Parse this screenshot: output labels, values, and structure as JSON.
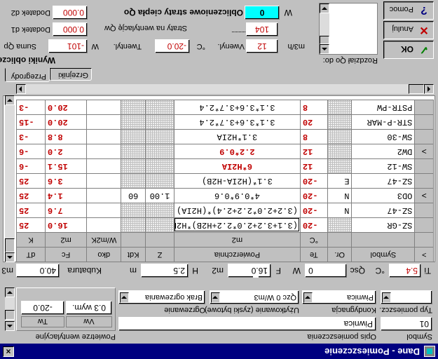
{
  "window": {
    "title": "Dane - Pomieszczenie",
    "close_glyph": "×"
  },
  "room": {
    "symbol_label": "Symbol",
    "symbol_value": "01",
    "description_label": "Opis pomieszczenia",
    "description_value": "Piwnica",
    "type_label": "Typ pomieszcz.",
    "type_value": "",
    "floor_label": "Kondygnacja",
    "floor_value": "Piwnica",
    "usage_label": "Użytkowanie (zyski bytowe)",
    "usage_value": "Qzc 0 W/m3",
    "heating_label": "Ogrzewanie",
    "heating_value": "Brak ogrzewania"
  },
  "ventilation_air": {
    "caption": "Powietrze wentylacyjne",
    "col_vw": "Vw",
    "col_tw": "Tw",
    "vw_value": "0.3  wym.",
    "tw_value": "-20.0"
  },
  "params": {
    "ti_label": "Ti",
    "ti_value": "5.4",
    "ti_unit": "°C",
    "qsc_label": "Qsc",
    "qsc_value": "0",
    "qsc_unit": "W",
    "f_label": "F",
    "f_value": "16.0",
    "f_unit": "m2",
    "h_label": "H",
    "h_value": "2.5",
    "h_unit": "m",
    "kub_label": "Kubatura",
    "kub_value": "40.0",
    "kub_unit": "m3"
  },
  "table": {
    "headers_row1": [
      ">",
      "Symbol",
      "Or.",
      "Te",
      "Powierzchnia",
      "Z",
      "Kdt",
      "dko",
      "Fc",
      "dT"
    ],
    "headers_row2": [
      "",
      "",
      "",
      "°C",
      "m2",
      "",
      "",
      "W/m2K",
      "m2",
      "K"
    ],
    "rows": [
      {
        "ind": "",
        "sym": "SZ-GR",
        "or": "",
        "te": "-20",
        "area": "(3.1+3.2+2.0*2.2+H2B)*H2R",
        "z": "",
        "kdt": "",
        "dko": "",
        "fc": "16.0",
        "dt": "25",
        "editing": true
      },
      {
        "ind": "",
        "sym": "SZ-47",
        "or": "N",
        "te": "-20",
        "area": "(3.2+2.0*2.2+2.4)*(H2IA)",
        "z": "",
        "kdt": "",
        "dko": "",
        "fc": "7.6",
        "dt": "25"
      },
      {
        "ind": ">",
        "sym": "OD3",
        "or": "N",
        "te": "-20",
        "area": "4*0.9*0.6",
        "z": "1.00",
        "kdt": "60",
        "dko": "",
        "fc": "1.4",
        "dt": "25"
      },
      {
        "ind": "",
        "sym": "SZ-47",
        "or": "E",
        "te": "-20",
        "area": "3.1*(H2IA-H2B)",
        "z": "",
        "kdt": "",
        "dko": "",
        "fc": "3.6",
        "dt": "25"
      },
      {
        "ind": "",
        "sym": "SW-12",
        "or": "",
        "te": "12",
        "area": "6*H2IA",
        "z": "",
        "kdt": "",
        "dko": "",
        "fc": "15.1",
        "dt": "-6"
      },
      {
        "ind": ">",
        "sym": "DW2",
        "or": "",
        "te": "12",
        "area": "2.2*0.9",
        "z": "",
        "kdt": "",
        "dko": "",
        "fc": "2.0",
        "dt": "-6"
      },
      {
        "ind": "",
        "sym": "SW-30",
        "or": "",
        "te": "8",
        "area": "3.1*H2IA",
        "z": "",
        "kdt": "",
        "dko": "",
        "fc": "8.8",
        "dt": "-3"
      },
      {
        "ind": "",
        "sym": "STR-P-MAR",
        "or": "",
        "te": "20",
        "area": "3.1*3.6+3.7*2.4",
        "z": "",
        "kdt": "",
        "dko": "",
        "fc": "20.0",
        "dt": "-15"
      },
      {
        "ind": "",
        "sym": "PSTR-PW",
        "or": "",
        "te": "8",
        "area": "3.1*3.6+3.7*2.4",
        "z": "",
        "kdt": "",
        "dko": "",
        "fc": "20.0",
        "dt": "-3"
      }
    ]
  },
  "tabs": {
    "tab1": "Przegrody",
    "tab2": "Grzejniki"
  },
  "summary": {
    "caption": "Wyniki obliczeń",
    "sum_label": "Suma Qp",
    "sum_value": "-101",
    "sum_unit": "W",
    "tvent_label": "Twentyl.",
    "tvent_value": "-20.0",
    "tvent_unit": "°C",
    "vvent_label": "Vwenyl.",
    "vvent_value": "12",
    "vvent_unit": "m3/h",
    "d1_label": "Dodatek d1",
    "d1_value": "0.000",
    "d2_label": "Dodatek d2",
    "d2_value": "0.000",
    "vent_loss_label": "Straty na wentylację Qw",
    "vent_loss_value": "104",
    "total_label": "Obliczeniowe straty ciepła Qo",
    "total_value": "0",
    "total_unit": "W"
  },
  "distribution_label": "Rozdział Qo do:",
  "buttons": {
    "ok": "OK",
    "cancel": "Anuluj",
    "help": "Pomoc"
  },
  "colors": {
    "title_bar": "#000080",
    "highlight_field": "#00ffff",
    "value_red": "#c00000",
    "ok_icon": "#008000",
    "cancel_icon": "#c00000",
    "help_icon": "#000080"
  }
}
